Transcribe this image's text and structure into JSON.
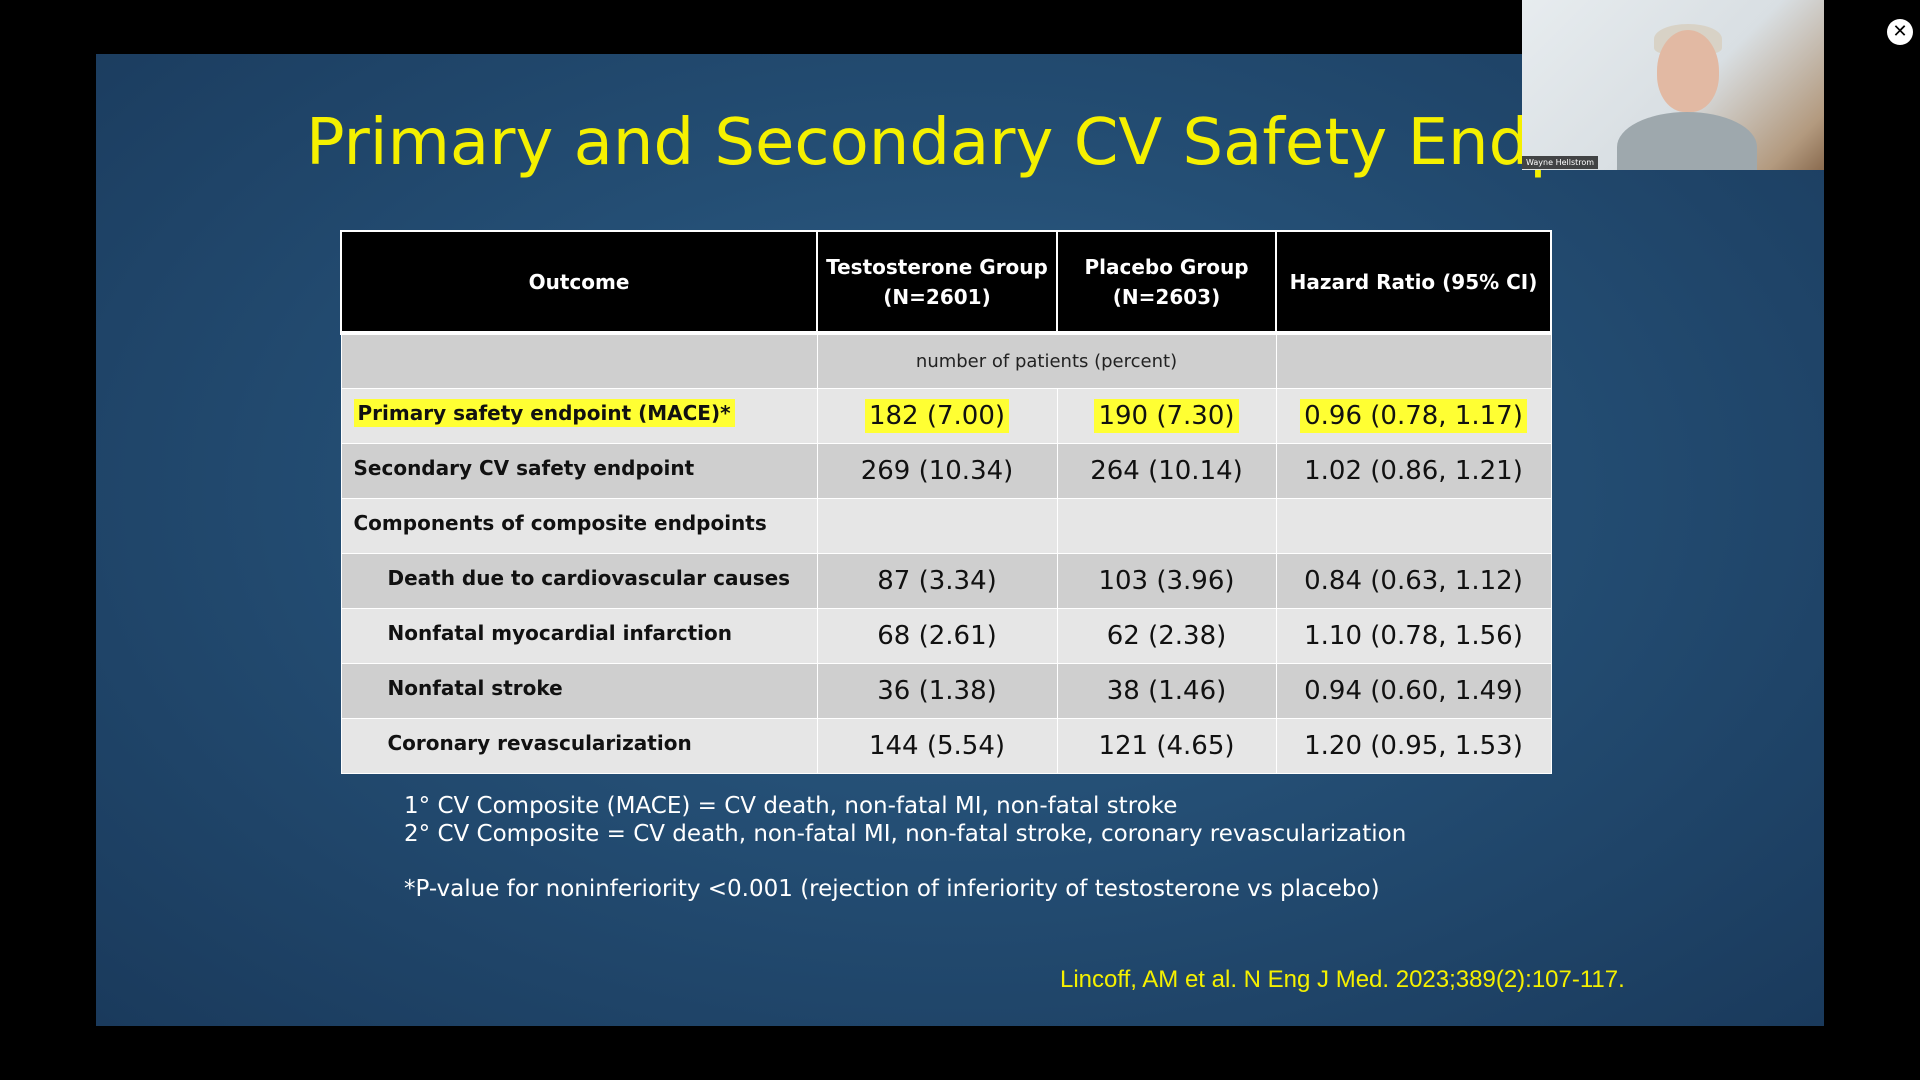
{
  "slide": {
    "title": "Primary and Secondary CV Safety Endpoin",
    "table": {
      "headers": [
        "Outcome",
        "Testosterone Group (N=2601)",
        "Placebo Group (N=2603)",
        "Hazard Ratio (95% CI)"
      ],
      "units_row": "number of patients (percent)",
      "rows": [
        {
          "label": "Primary safety endpoint (MACE)*",
          "testosterone": "182 (7.00)",
          "placebo": "190 (7.30)",
          "hazard_ratio": "0.96 (0.78, 1.17)",
          "highlight": true
        },
        {
          "label": "Secondary CV safety endpoint",
          "testosterone": "269 (10.34)",
          "placebo": "264 (10.14)",
          "hazard_ratio": "1.02 (0.86, 1.21)"
        },
        {
          "label": "Components of composite endpoints",
          "testosterone": "",
          "placebo": "",
          "hazard_ratio": ""
        },
        {
          "label": "Death due to cardiovascular causes",
          "testosterone": "87 (3.34)",
          "placebo": "103 (3.96)",
          "hazard_ratio": "0.84 (0.63, 1.12)"
        },
        {
          "label": "Nonfatal myocardial infarction",
          "testosterone": "68 (2.61)",
          "placebo": "62 (2.38)",
          "hazard_ratio": "1.10 (0.78, 1.56)"
        },
        {
          "label": "Nonfatal stroke",
          "testosterone": "36 (1.38)",
          "placebo": "38 (1.46)",
          "hazard_ratio": "0.94 (0.60, 1.49)"
        },
        {
          "label": "Coronary revascularization",
          "testosterone": "144 (5.54)",
          "placebo": "121 (4.65)",
          "hazard_ratio": "1.20 (0.95, 1.53)"
        }
      ]
    },
    "notes": {
      "line1": "1° CV Composite (MACE) = CV death, non-fatal MI, non-fatal stroke",
      "line2": "2° CV Composite = CV death, non-fatal MI, non-fatal stroke, coronary revascularization",
      "line3": "*P-value for noninferiority <0.001 (rejection of inferiority of testosterone vs placebo)"
    },
    "citation": "Lincoff, AM et al. N Eng J Med. 2023;389(2):107-117."
  },
  "webcam": {
    "participant_name": "Wayne Hellstrom"
  },
  "controls": {
    "close_glyph": "✕"
  },
  "colors": {
    "title_yellow": "#f5f000",
    "highlight_yellow": "#ffff33",
    "slide_blue": "#244e74"
  }
}
